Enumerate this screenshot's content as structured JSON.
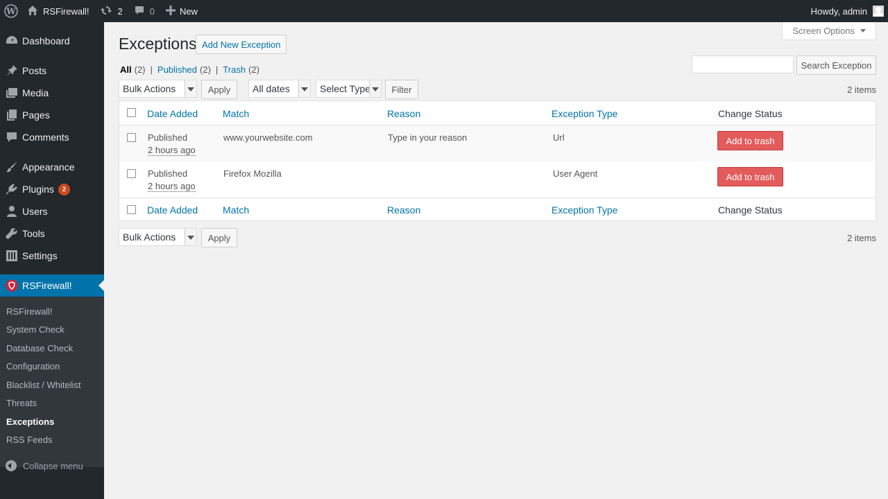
{
  "adminbar": {
    "site_name": "RSFirewall!",
    "updates_count": "2",
    "comments_count": "0",
    "new_label": "New",
    "greeting": "Howdy, admin"
  },
  "sidebar": {
    "items": [
      {
        "label": "Dashboard",
        "icon": "dashboard-icon"
      },
      {
        "label": "Posts",
        "icon": "pin-icon"
      },
      {
        "label": "Media",
        "icon": "media-icon"
      },
      {
        "label": "Pages",
        "icon": "pages-icon"
      },
      {
        "label": "Comments",
        "icon": "comment-icon"
      },
      {
        "label": "Appearance",
        "icon": "brush-icon"
      },
      {
        "label": "Plugins",
        "icon": "plugin-icon",
        "badge": "2"
      },
      {
        "label": "Users",
        "icon": "users-icon"
      },
      {
        "label": "Tools",
        "icon": "wrench-icon"
      },
      {
        "label": "Settings",
        "icon": "settings-icon"
      },
      {
        "label": "RSFirewall!",
        "icon": "shield-icon"
      }
    ],
    "submenu": [
      "RSFirewall!",
      "System Check",
      "Database Check",
      "Configuration",
      "Blacklist / Whitelist",
      "Threats",
      "Exceptions",
      "RSS Feeds"
    ],
    "collapse_label": "Collapse menu"
  },
  "screen_options": "Screen Options",
  "page": {
    "title": "Exceptions",
    "add_new": "Add New Exception",
    "filters": {
      "all": "All",
      "all_count": "(2)",
      "published": "Published",
      "published_count": "(2)",
      "trash": "Trash",
      "trash_count": "(2)"
    },
    "search_button": "Search Exception",
    "bulk_actions": "Bulk Actions",
    "apply": "Apply",
    "all_dates": "All dates",
    "select_type": "Select Type",
    "filter": "Filter",
    "items_count": "2 items"
  },
  "table": {
    "columns": [
      "Date Added",
      "Match",
      "Reason",
      "Exception Type",
      "Change Status"
    ],
    "rows": [
      {
        "status": "Published",
        "ago": "2 hours ago",
        "match": "www.yourwebsite.com",
        "reason": "Type in your reason",
        "type": "Url",
        "action": "Add to trash"
      },
      {
        "status": "Published",
        "ago": "2 hours ago",
        "match": "Firefox Mozilla",
        "reason": "",
        "type": "User Agent",
        "action": "Add to trash"
      }
    ]
  },
  "colors": {
    "accent": "#0073aa",
    "sidebar_bg": "#23282d",
    "trash_button": "#e35b5b"
  }
}
